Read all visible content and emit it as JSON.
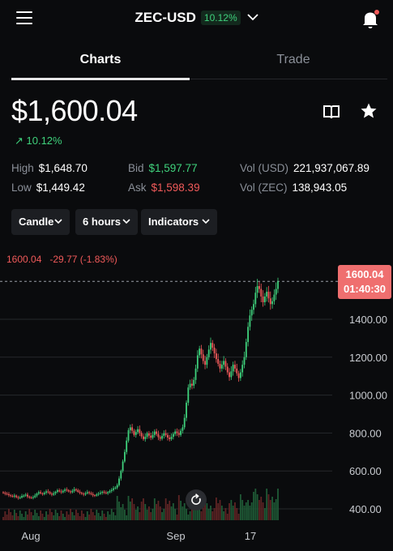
{
  "header": {
    "title": "ZEC-USD",
    "change": "10.12%"
  },
  "tabs": [
    {
      "label": "Charts"
    },
    {
      "label": "Trade"
    }
  ],
  "price": "$1,600.04",
  "change": "↗ 10.12%",
  "stats": {
    "high": {
      "label": "High",
      "value": "$1,648.70"
    },
    "low": {
      "label": "Low",
      "value": "$1,449.42"
    },
    "bid": {
      "label": "Bid",
      "value": "$1,597.77"
    },
    "ask": {
      "label": "Ask",
      "value": "$1,598.39"
    },
    "vol_usd": {
      "label": "Vol (USD)",
      "value": "221,937,067.89"
    },
    "vol_zec": {
      "label": "Vol (ZEC)",
      "value": "138,943.05"
    }
  },
  "controls": {
    "chart_type": "Candle",
    "interval": "6 hours",
    "indicators": "Indicators"
  },
  "chart_info": {
    "last": "1600.04",
    "delta": "-29.77 (-1.83%)"
  },
  "price_tag": {
    "price": "1600.04",
    "countdown": "01:40:30"
  },
  "colors": {
    "up": "#3fd17c",
    "down": "#f05a5a",
    "accent": "#ef6f6f",
    "bg": "#0a0b0d"
  },
  "icons": [
    "menu-icon",
    "chevron-down-icon",
    "bell-icon",
    "book-icon",
    "star-icon",
    "reset-icon"
  ],
  "chart_data": {
    "type": "candlestick",
    "x_ticks": [
      "Aug",
      "Sep",
      "17"
    ],
    "y_ticks": [
      400,
      600,
      800,
      1000,
      1200,
      1400
    ],
    "ylim": [
      360,
      1700
    ],
    "grid": true,
    "last_price": 1600.04,
    "close_series": [
      485,
      480,
      478,
      472,
      468,
      465,
      470,
      462,
      458,
      460,
      468,
      470,
      475,
      465,
      460,
      458,
      462,
      470,
      480,
      488,
      482,
      478,
      485,
      492,
      488,
      480,
      475,
      482,
      490,
      498,
      492,
      488,
      495,
      502,
      498,
      492,
      488,
      495,
      503,
      498,
      490,
      485,
      480,
      476,
      482,
      488,
      483,
      478,
      472,
      470,
      476,
      480,
      485,
      490,
      486,
      482,
      488,
      494,
      500,
      508,
      512,
      525,
      560,
      600,
      650,
      700,
      760,
      815,
      830,
      812,
      790,
      805,
      820,
      800,
      782,
      768,
      780,
      798,
      786,
      775,
      790,
      808,
      795,
      778,
      770,
      785,
      798,
      790,
      776,
      768,
      780,
      795,
      808,
      800,
      790,
      812,
      830,
      880,
      960,
      1040,
      1060,
      1050,
      1080,
      1140,
      1210,
      1245,
      1215,
      1180,
      1160,
      1200,
      1240,
      1275,
      1250,
      1220,
      1190,
      1165,
      1140,
      1160,
      1180,
      1150,
      1120,
      1095,
      1125,
      1160,
      1140,
      1115,
      1090,
      1120,
      1160,
      1200,
      1280,
      1360,
      1420,
      1450,
      1480,
      1540,
      1575,
      1560,
      1520,
      1490,
      1520,
      1545,
      1510,
      1480,
      1495,
      1530,
      1560,
      1600
    ]
  }
}
